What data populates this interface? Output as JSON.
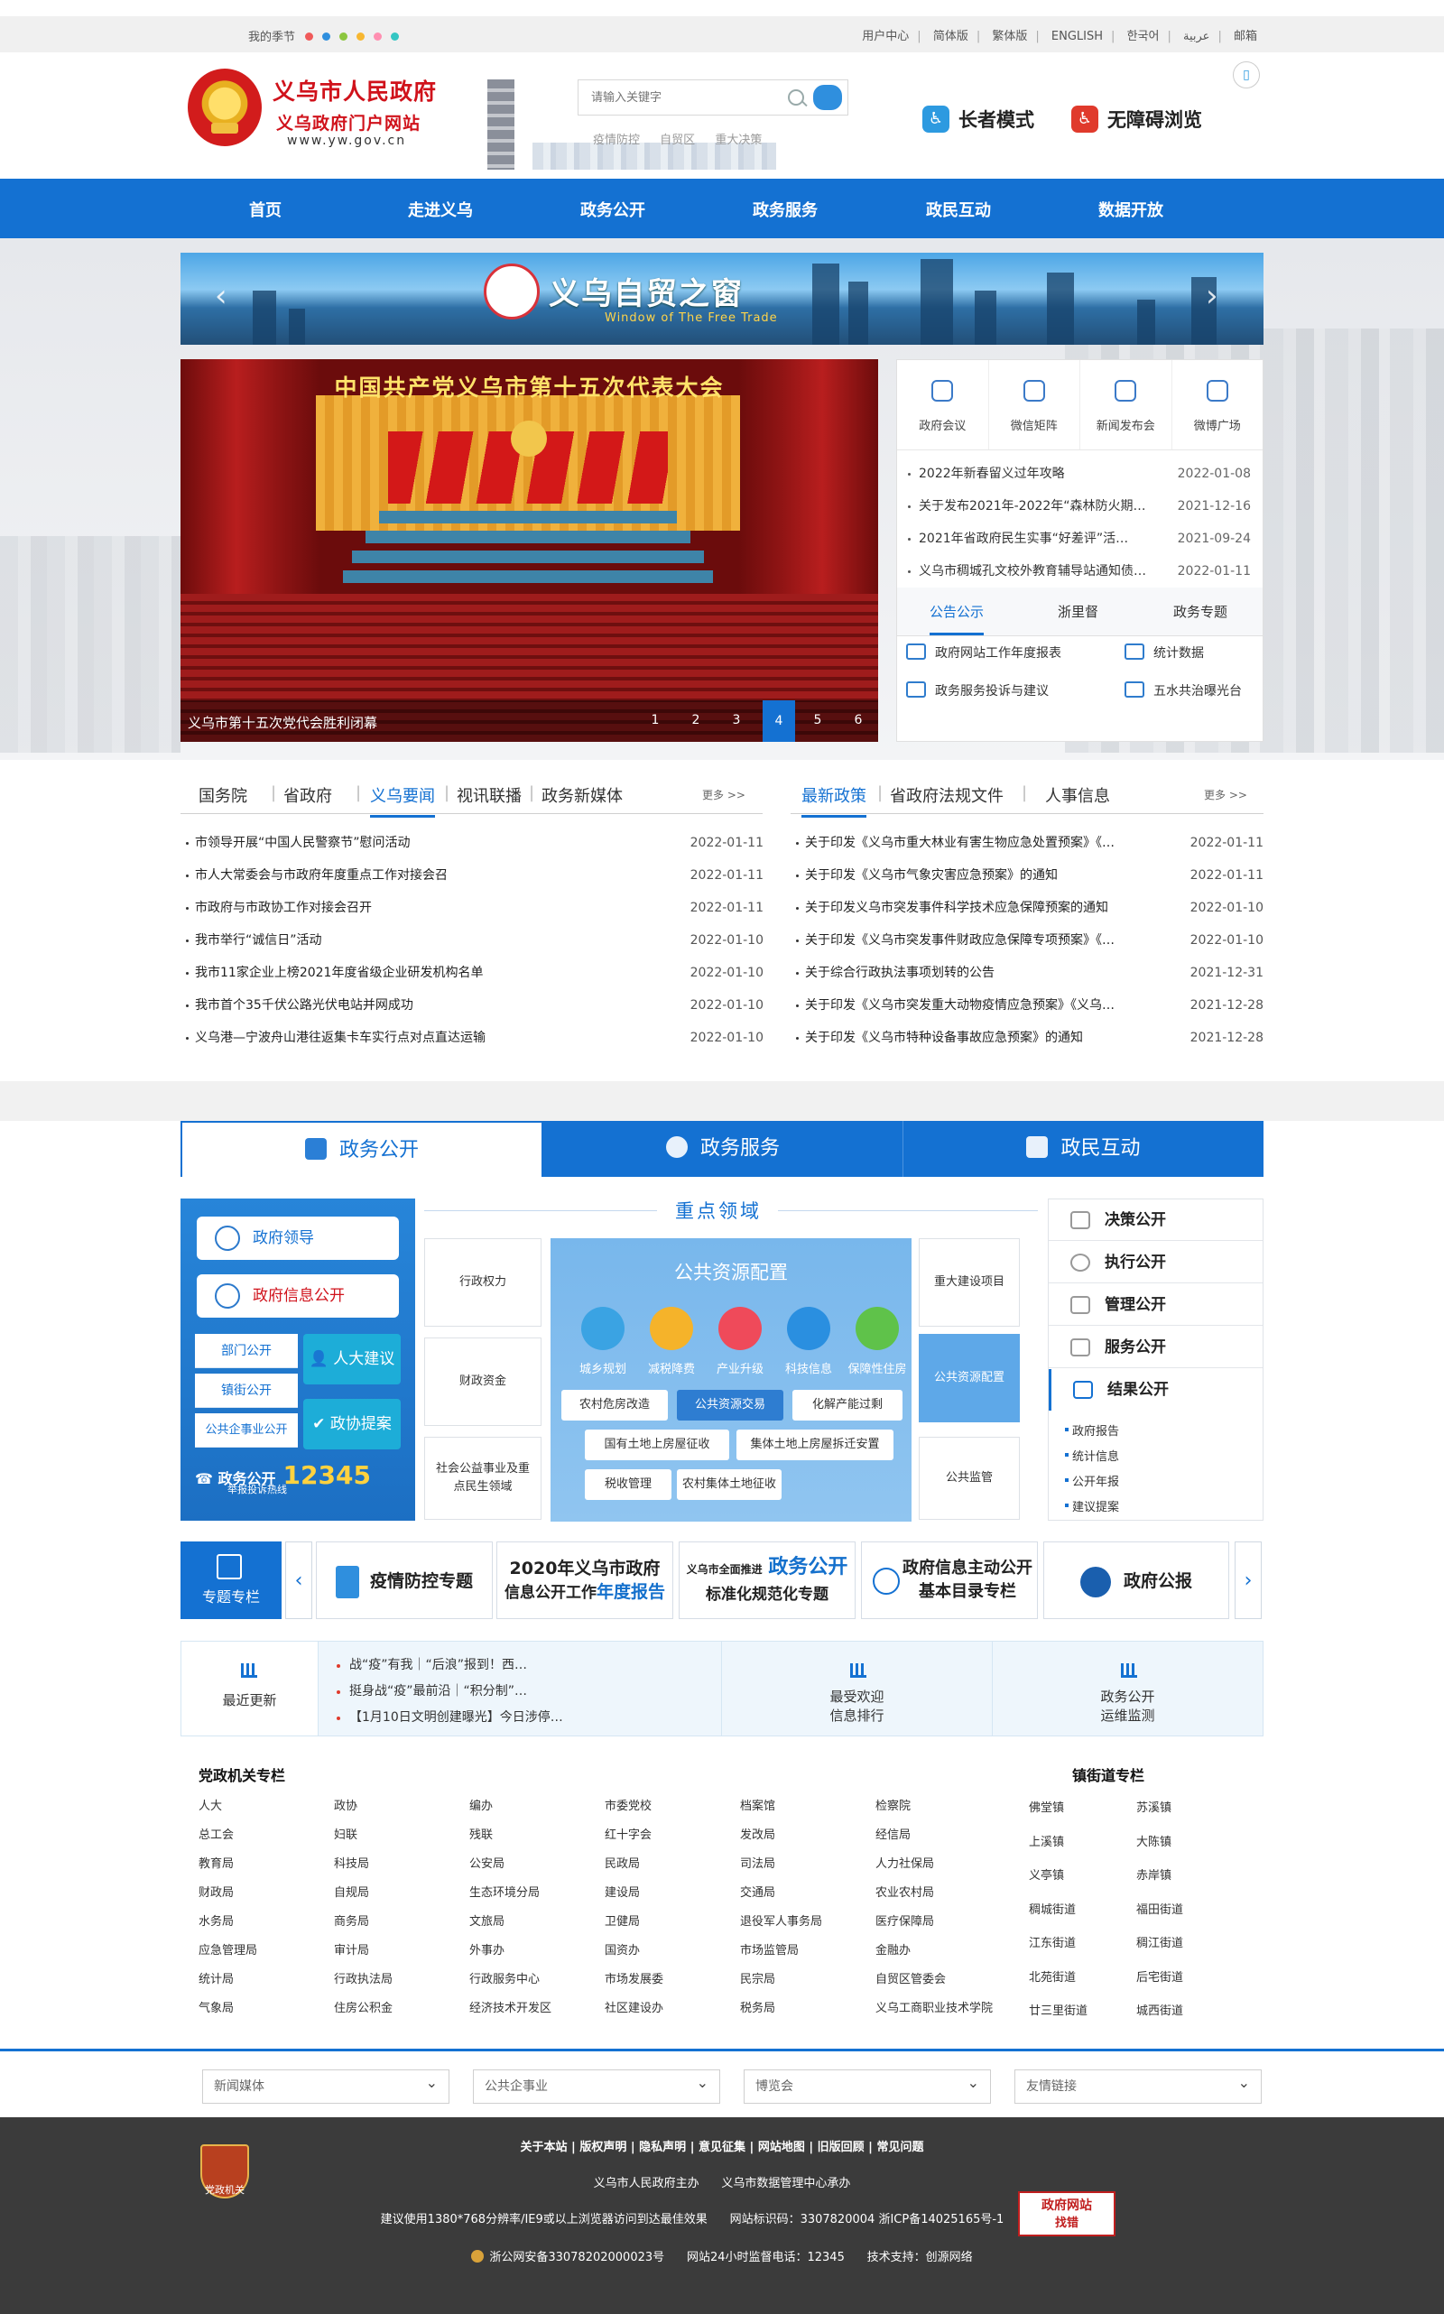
{
  "topbar": {
    "season": "我的季节",
    "dot_colors": [
      "#f05a5a",
      "#2f8fde",
      "#8cc63f",
      "#f7b731",
      "#ff8fb1",
      "#34c6c3"
    ],
    "links": [
      "用户中心",
      "简体版",
      "繁体版",
      "ENGLISH",
      "한국어",
      "عربية",
      "邮箱"
    ]
  },
  "header": {
    "site_title": "义乌市人民政府",
    "site_subtitle": "义乌政府门户网站",
    "site_url": "www.yw.gov.cn",
    "search_placeholder": "请输入关键字",
    "hot_words": [
      "疫情防控",
      "自贸区",
      "重大决策"
    ],
    "elder_mode": "长者模式",
    "accessible": "无障碍浏览"
  },
  "nav": [
    "首页",
    "走进义乌",
    "政务公开",
    "政务服务",
    "政民互动",
    "数据开放"
  ],
  "banner": {
    "title": "义乌自贸之窗",
    "subtitle": "Window of The Free Trade"
  },
  "slide": {
    "slogan": "中国共产党义乌市第十五次代表大会",
    "caption": "义乌市第十五次党代会胜利闭幕",
    "pages": [
      "1",
      "2",
      "3",
      "4",
      "5",
      "6"
    ],
    "active_page": "4"
  },
  "side_panel": {
    "icons": [
      "政府会议",
      "微信矩阵",
      "新闻发布会",
      "微博广场"
    ],
    "news": [
      {
        "title": "2022年新春留义过年攻略",
        "date": "2022-01-08"
      },
      {
        "title": "关于发布2021年-2022年“森林防火期…",
        "date": "2021-12-16"
      },
      {
        "title": "2021年省政府民生实事“好差评”活…",
        "date": "2021-09-24"
      },
      {
        "title": "义乌市稠城孔文校外教育辅导站通知债…",
        "date": "2022-01-11"
      }
    ],
    "tabs": [
      "公告公示",
      "浙里督",
      "政务专题"
    ],
    "quick": [
      "政府网站工作年度报表",
      "统计数据",
      "政务服务投诉与建议",
      "五水共治曝光台"
    ]
  },
  "news_left": {
    "tabs": [
      "国务院",
      "省政府",
      "义乌要闻",
      "视讯联播",
      "政务新媒体"
    ],
    "active": "义乌要闻",
    "more": "更多 >>",
    "items": [
      {
        "title": "市领导开展“中国人民警察节”慰问活动",
        "date": "2022-01-11"
      },
      {
        "title": "市人大常委会与市政府年度重点工作对接会召",
        "date": "2022-01-11"
      },
      {
        "title": "市政府与市政协工作对接会召开",
        "date": "2022-01-11"
      },
      {
        "title": "我市举行“诚信日”活动",
        "date": "2022-01-10"
      },
      {
        "title": "我市11家企业上榜2021年度省级企业研发机构名单",
        "date": "2022-01-10"
      },
      {
        "title": "我市首个35千伏公路光伏电站并网成功",
        "date": "2022-01-10"
      },
      {
        "title": "义乌港—宁波舟山港往返集卡车实行点对点直达运输",
        "date": "2022-01-10"
      }
    ]
  },
  "news_right": {
    "tabs": [
      "最新政策",
      "省政府法规文件",
      "人事信息"
    ],
    "active": "最新政策",
    "more": "更多 >>",
    "items": [
      {
        "title": "关于印发《义乌市重大林业有害生物应急处置预案》《…",
        "date": "2022-01-11"
      },
      {
        "title": "关于印发《义乌市气象灾害应急预案》的通知",
        "date": "2022-01-11"
      },
      {
        "title": "关于印发义乌市突发事件科学技术应急保障预案的通知",
        "date": "2022-01-10"
      },
      {
        "title": "关于印发《义乌市突发事件财政应急保障专项预案》《…",
        "date": "2022-01-10"
      },
      {
        "title": "关于综合行政执法事项划转的公告",
        "date": "2021-12-31"
      },
      {
        "title": "关于印发《义乌市突发重大动物疫情应急预案》《义乌…",
        "date": "2021-12-28"
      },
      {
        "title": "关于印发《义乌市特种设备事故应急预案》的通知",
        "date": "2021-12-28"
      }
    ]
  },
  "service_tabs": [
    "政务公开",
    "政务服务",
    "政民互动"
  ],
  "left_column": {
    "leaders": "政府领导",
    "info_public": "政府信息公开",
    "small": [
      "部门公开",
      "镇街公开",
      "公共企事业公开"
    ],
    "cyan": [
      "人大建议",
      "政协提案"
    ],
    "hotline_label": "政务公开",
    "hotline_number": "12345",
    "hotline_sub": "举报投诉热线"
  },
  "key_area": {
    "title": "重点领域",
    "boxes_left": [
      "行政权力",
      "财政资金",
      "社会公益事业及重点民生领域"
    ],
    "boxes_right": [
      "重大建设项目",
      "公共资源配置",
      "公共监管"
    ],
    "pub_title": "公共资源配置",
    "circles": [
      {
        "label": "城乡规划",
        "color": "#3aa3e3"
      },
      {
        "label": "减税降费",
        "color": "#f5b32a"
      },
      {
        "label": "产业升级",
        "color": "#ef4a5a"
      },
      {
        "label": "科技信息",
        "color": "#2a8fe0"
      },
      {
        "label": "保障性住房",
        "color": "#5fc24a"
      }
    ],
    "tags": [
      "农村危房改造",
      "公共资源交易",
      "化解产能过剩",
      "国有土地上房屋征收",
      "集体土地上房屋拆迁安置",
      "税收管理",
      "农村集体土地征收"
    ],
    "active_tag": "公共资源交易"
  },
  "right_column": {
    "items": [
      "决策公开",
      "执行公开",
      "管理公开",
      "服务公开",
      "结果公开"
    ],
    "active": "结果公开",
    "sub": [
      "政府报告",
      "统计信息",
      "公开年报",
      "建议提案"
    ]
  },
  "feature_strip": {
    "label": "专题专栏",
    "items": [
      {
        "line1": "疫情防控专题",
        "line2": ""
      },
      {
        "line1": "2020年义乌市政府",
        "line2": "信息公开工作",
        "line3": "年度报告"
      },
      {
        "line1": "义乌市全面推进",
        "line2": "政务公开",
        "line3": "标准化规范化专题"
      },
      {
        "line1": "政府信息主动公开",
        "line2": "基本目录专栏"
      },
      {
        "line1": "政府公报",
        "line2": ""
      }
    ]
  },
  "updates": {
    "label": "最近更新",
    "items": [
      "战“疫”有我｜“后浪”报到！西…",
      "挺身战“疫”最前沿｜“积分制”…",
      "【1月10日文明创建曝光】今日涉停…"
    ],
    "welcome": [
      "最受欢迎",
      "信息排行"
    ],
    "monitor": [
      "政务公开",
      "运维监测"
    ]
  },
  "directory": {
    "party_title": "党政机关专栏",
    "party": [
      [
        "人大",
        "政协",
        "编办",
        "市委党校",
        "档案馆",
        "检察院"
      ],
      [
        "总工会",
        "妇联",
        "残联",
        "红十字会",
        "发改局",
        "经信局"
      ],
      [
        "教育局",
        "科技局",
        "公安局",
        "民政局",
        "司法局",
        "人力社保局"
      ],
      [
        "财政局",
        "自规局",
        "生态环境分局",
        "建设局",
        "交通局",
        "农业农村局"
      ],
      [
        "水务局",
        "商务局",
        "文旅局",
        "卫健局",
        "退役军人事务局",
        "医疗保障局"
      ],
      [
        "应急管理局",
        "审计局",
        "外事办",
        "国资办",
        "市场监管局",
        "金融办"
      ],
      [
        "统计局",
        "行政执法局",
        "行政服务中心",
        "市场发展委",
        "民宗局",
        "自贸区管委会"
      ],
      [
        "气象局",
        "住房公积金",
        "经济技术开发区",
        "社区建设办",
        "税务局",
        "义乌工商职业技术学院"
      ]
    ],
    "town_title": "镇街道专栏",
    "towns": [
      [
        "佛堂镇",
        "苏溪镇"
      ],
      [
        "上溪镇",
        "大陈镇"
      ],
      [
        "义亭镇",
        "赤岸镇"
      ],
      [
        "稠城街道",
        "福田街道"
      ],
      [
        "江东街道",
        "稠江街道"
      ],
      [
        "北苑街道",
        "后宅街道"
      ],
      [
        "廿三里街道",
        "城西街道"
      ]
    ]
  },
  "selects": [
    "新闻媒体",
    "公共企事业",
    "博览会",
    "友情链接"
  ],
  "footer": {
    "badge": "党政机关",
    "links": [
      "关于本站",
      "版权声明",
      "隐私声明",
      "意见征集",
      "网站地图",
      "旧版回顾",
      "常见问题"
    ],
    "host": "义乌市人民政府主办",
    "organizer": "义乌市数据管理中心承办",
    "advice": "建议使用1380*768分辨率/IE9或以上浏览器访问到达最佳效果",
    "site_code": "网站标识码：3307820004",
    "icp": "浙ICP备14025165号-1",
    "police": "浙公网安备33078202000023号",
    "hotline": "网站24小时监督电话：12345",
    "tech": "技术支持：创源网络",
    "find_error": "政府网站",
    "find_error2": "找错"
  }
}
